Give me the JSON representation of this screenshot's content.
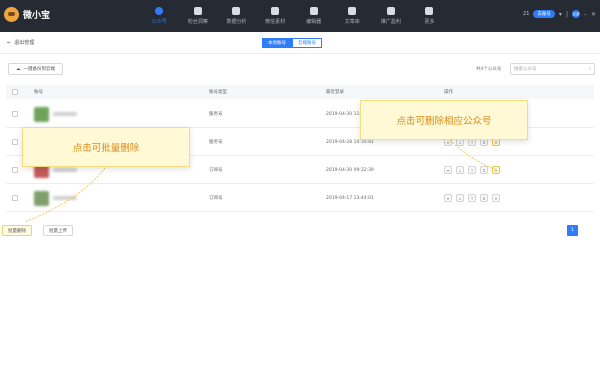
{
  "app": {
    "name": "微小宝"
  },
  "nav": [
    {
      "label": "公众号",
      "icon": "person-icon",
      "active": true
    },
    {
      "label": "粉丝洞察",
      "icon": "chat-icon",
      "active": false
    },
    {
      "label": "数据分析",
      "icon": "bar-chart-icon",
      "active": false
    },
    {
      "label": "微信素材",
      "icon": "gamepad-icon",
      "active": false
    },
    {
      "label": "编辑器",
      "icon": "pen-icon",
      "active": false
    },
    {
      "label": "文章库",
      "icon": "trash-icon",
      "active": false
    },
    {
      "label": "推广盈利",
      "icon": "money-bag-icon",
      "active": false
    },
    {
      "label": "更多",
      "icon": "grid-icon",
      "active": false
    }
  ],
  "user": {
    "id": "21",
    "badge": "去账号",
    "avatar": "VIP"
  },
  "subbar": {
    "back_label": "退出管理",
    "seg_local": "本地账号",
    "seg_cloud": "云端账号"
  },
  "toolbar": {
    "sync_label": "一键备份到云端",
    "count_label": "共4个公众号",
    "search_placeholder": "搜索公众号"
  },
  "table": {
    "headers": {
      "account": "账号",
      "type": "账号类型",
      "last_login": "最近登录",
      "ops": "操作"
    },
    "rows": [
      {
        "type": "服务号",
        "last_login": "2019-04-30 11:",
        "thumb_color": "#6fa35a"
      },
      {
        "type": "服务号",
        "last_login": "2019-04-28 10:35:41",
        "thumb_color": "#8aa36a"
      },
      {
        "type": "订阅号",
        "last_login": "2019-04-30 09:32:39",
        "thumb_color": "#c45a5a"
      },
      {
        "type": "订阅号",
        "last_login": "2019-04-17 13:44:01",
        "thumb_color": "#7fa06a"
      }
    ]
  },
  "bottom": {
    "batch_delete": "批量删除",
    "batch_upload": "批量上传",
    "page": "1"
  },
  "callouts": {
    "batch_delete_tip": "点击可批量删除",
    "delete_tip": "点击可删除相应公众号"
  },
  "colors": {
    "accent": "#2f7cf6",
    "topbar": "#262a33",
    "callout_text": "#d98b1a"
  }
}
